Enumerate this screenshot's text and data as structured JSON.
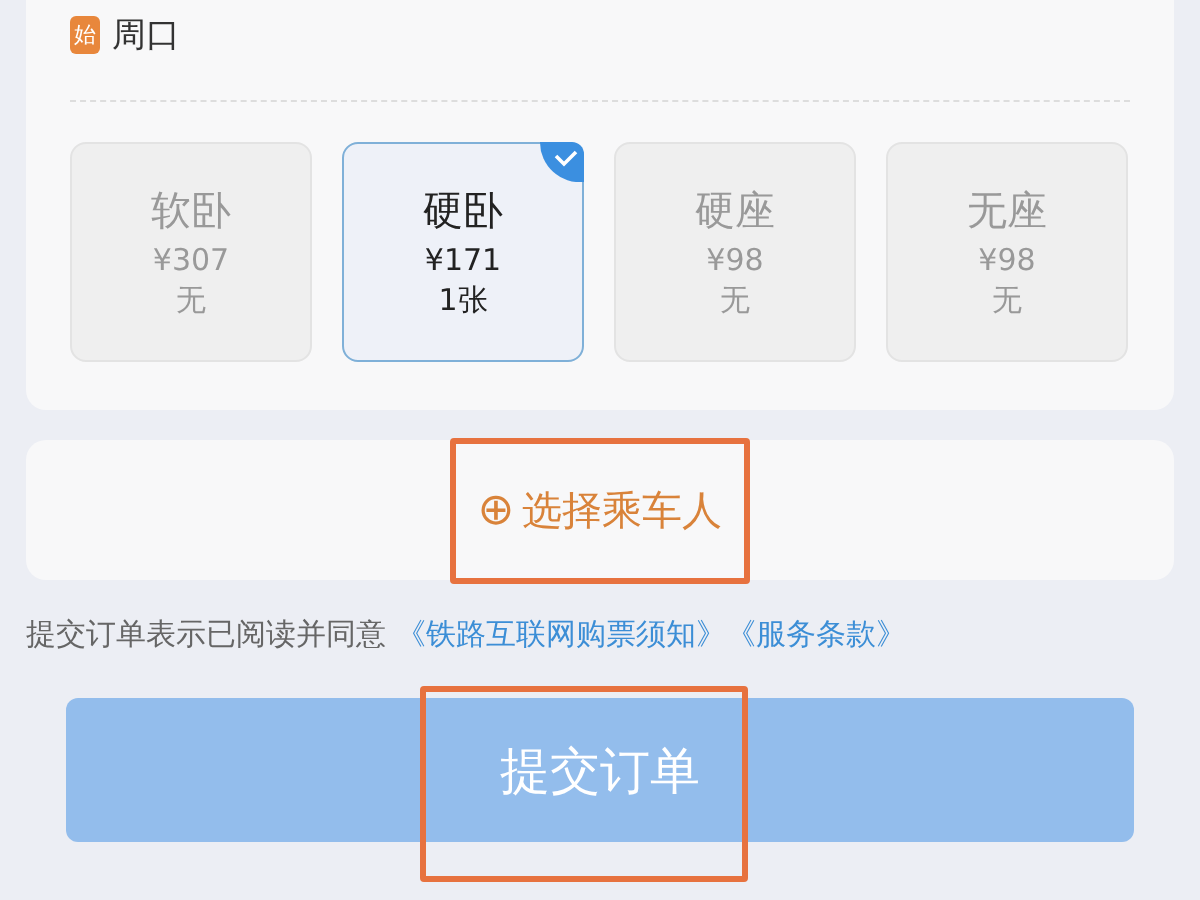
{
  "origin": {
    "badge": "始",
    "station": "周口"
  },
  "seats": [
    {
      "name": "软卧",
      "price": "¥307",
      "availability": "无",
      "selected": false
    },
    {
      "name": "硬卧",
      "price": "¥171",
      "availability": "1张",
      "selected": true
    },
    {
      "name": "硬座",
      "price": "¥98",
      "availability": "无",
      "selected": false
    },
    {
      "name": "无座",
      "price": "¥98",
      "availability": "无",
      "selected": false
    }
  ],
  "passenger_button": {
    "icon": "⊕",
    "label": "选择乘车人",
    "highlighted": true
  },
  "agreement": {
    "text": "提交订单表示已阅读并同意",
    "links": [
      "《铁路互联网购票须知》",
      "《服务条款》"
    ]
  },
  "submit_button": {
    "label": "提交订单",
    "highlighted": true
  }
}
